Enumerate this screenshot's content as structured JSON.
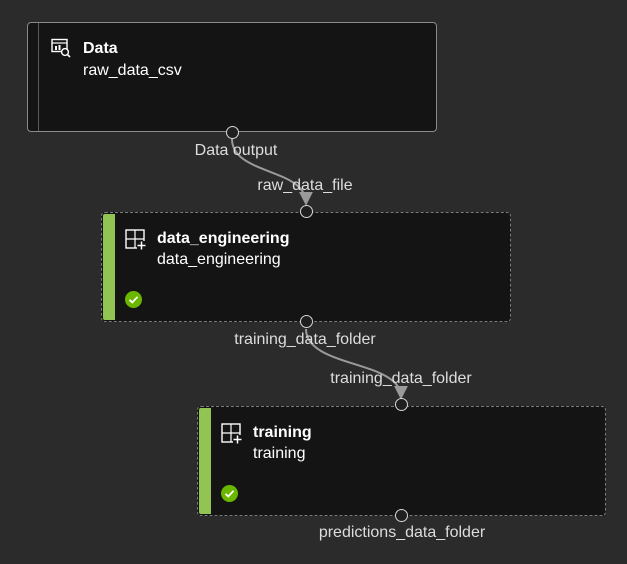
{
  "nodes": {
    "data": {
      "title": "Data",
      "subtitle": "raw_data_csv",
      "icon": "dataset-icon",
      "output_port_label": "Data output"
    },
    "data_engineering": {
      "title": "data_engineering",
      "subtitle": "data_engineering",
      "icon": "component-icon",
      "status": "completed",
      "input_port_label": "raw_data_file",
      "output_port_label": "training_data_folder"
    },
    "training": {
      "title": "training",
      "subtitle": "training",
      "icon": "component-icon",
      "status": "completed",
      "input_port_label": "training_data_folder",
      "output_port_label": "predictions_data_folder"
    }
  },
  "colors": {
    "background": "#2b2b2b",
    "node_fill": "#141414",
    "accent_success": "#92c353",
    "status_check": "#6bb700",
    "edge": "#9a9a9a",
    "port_stroke": "#d6d6d6"
  },
  "edges": [
    {
      "from": "data.output",
      "to": "data_engineering.input"
    },
    {
      "from": "data_engineering.output",
      "to": "training.input"
    }
  ]
}
